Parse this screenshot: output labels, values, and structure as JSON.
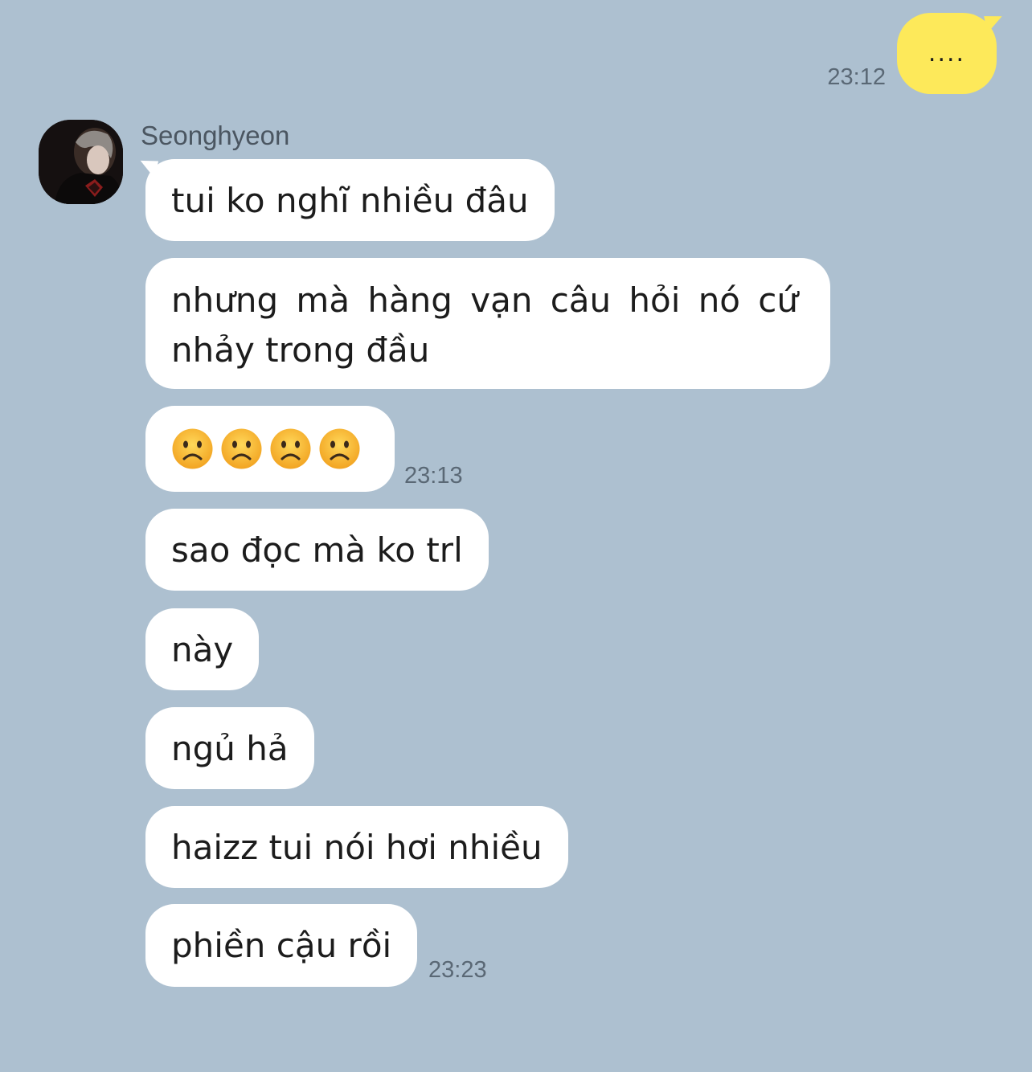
{
  "outgoing": {
    "text": "....",
    "time": "23:12",
    "bubble_color": "#fde95a"
  },
  "contact": {
    "name": "Seonghyeon",
    "avatar_icon": "profile-photo"
  },
  "messages": [
    {
      "text": "tui ko nghĩ nhiều đâu"
    },
    {
      "text": "nhưng mà hàng vạn câu hỏi nó cứ nhảy trong đầu"
    },
    {
      "emoji": [
        "frowning-face",
        "frowning-face",
        "frowning-face",
        "frowning-face"
      ],
      "time": "23:13"
    },
    {
      "text": "sao đọc mà ko trl"
    },
    {
      "text": "này"
    },
    {
      "text": "ngủ hả"
    },
    {
      "text": "haizz tui nói hơi nhiều"
    },
    {
      "text": "phiền cậu rồi",
      "time": "23:23"
    }
  ],
  "colors": {
    "background": "#adc0d0",
    "incoming_bubble": "#ffffff",
    "timestamp": "#5a6875"
  }
}
